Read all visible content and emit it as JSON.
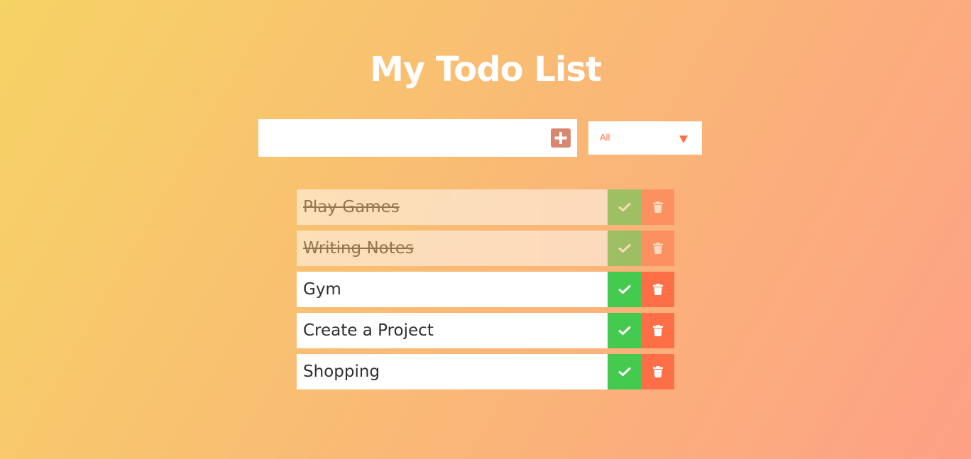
{
  "header": {
    "title": "My Todo List"
  },
  "add_form": {
    "input_value": "",
    "input_placeholder": "",
    "add_icon": "plus-square-icon"
  },
  "filter": {
    "selected": "All",
    "options": [
      "All"
    ]
  },
  "todos": [
    {
      "text": "Play Games",
      "completed": true
    },
    {
      "text": "Writing Notes",
      "completed": true
    },
    {
      "text": "Gym",
      "completed": false
    },
    {
      "text": "Create a Project",
      "completed": false
    },
    {
      "text": "Shopping",
      "completed": false
    }
  ],
  "icons": {
    "complete": "check-icon",
    "delete": "trash-icon"
  },
  "colors": {
    "gradient_start": "#f6d365",
    "gradient_end": "#fda085",
    "complete_button": "#44ca4e",
    "delete_button": "#ff6f47",
    "add_button": "#d88771",
    "filter_text": "#ff6f47"
  }
}
